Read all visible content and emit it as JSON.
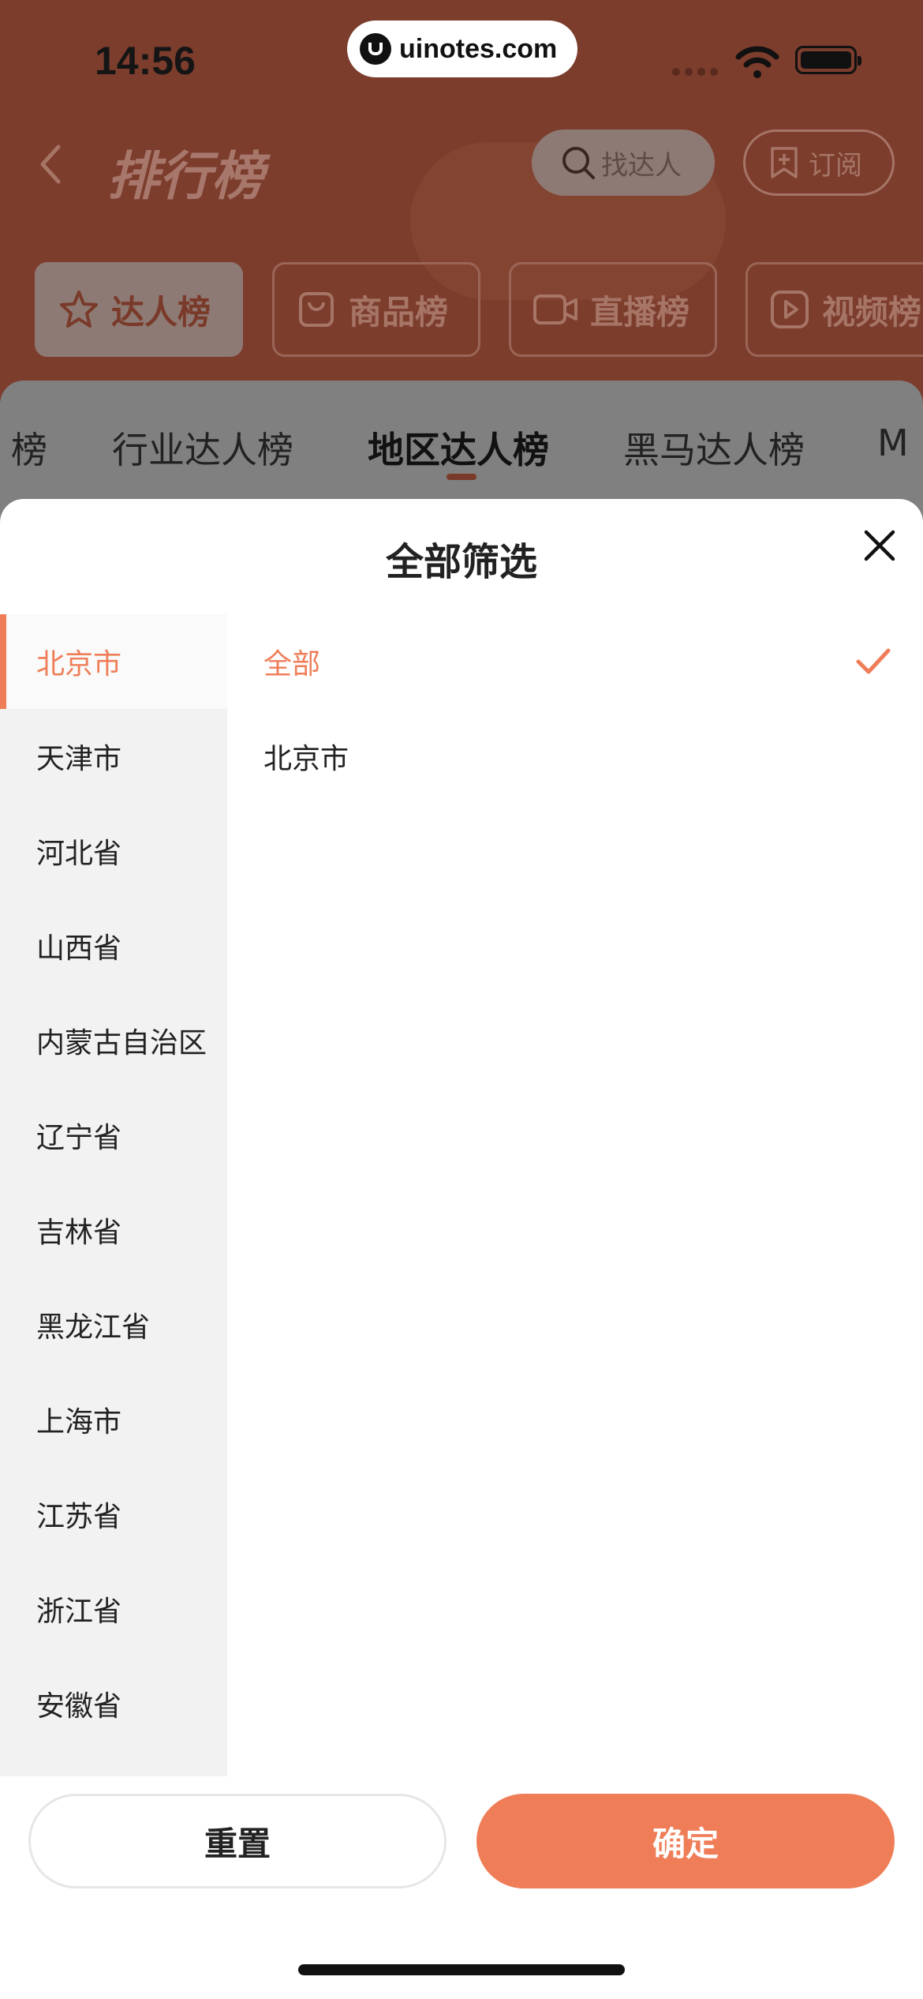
{
  "status_bar": {
    "time": "14:56"
  },
  "watermark": {
    "text": "uinotes.com"
  },
  "nav": {
    "title": "排行榜",
    "search_placeholder": "找达人",
    "subscribe_label": "订阅"
  },
  "category_tabs": [
    {
      "label": "达人榜",
      "icon": "star-icon",
      "active": true
    },
    {
      "label": "商品榜",
      "icon": "bag-icon",
      "active": false
    },
    {
      "label": "直播榜",
      "icon": "camera-icon",
      "active": false
    },
    {
      "label": "视频榜",
      "icon": "play-icon",
      "active": false
    }
  ],
  "sub_tabs": [
    {
      "label": "榜",
      "active": false
    },
    {
      "label": "行业达人榜",
      "active": false
    },
    {
      "label": "地区达人榜",
      "active": true
    },
    {
      "label": "黑马达人榜",
      "active": false
    },
    {
      "label": "M",
      "active": false
    }
  ],
  "filter_sheet": {
    "title": "全部筛选",
    "provinces": [
      {
        "label": "北京市",
        "active": true
      },
      {
        "label": "天津市"
      },
      {
        "label": "河北省"
      },
      {
        "label": "山西省"
      },
      {
        "label": "内蒙古自治区"
      },
      {
        "label": "辽宁省"
      },
      {
        "label": "吉林省"
      },
      {
        "label": "黑龙江省"
      },
      {
        "label": "上海市"
      },
      {
        "label": "江苏省"
      },
      {
        "label": "浙江省"
      },
      {
        "label": "安徽省"
      }
    ],
    "cities": [
      {
        "label": "全部",
        "selected": true
      },
      {
        "label": "北京市",
        "selected": false
      }
    ],
    "reset_label": "重置",
    "confirm_label": "确定"
  },
  "colors": {
    "accent": "#ef7e58",
    "overlay_bg": "#7c3d2d"
  }
}
